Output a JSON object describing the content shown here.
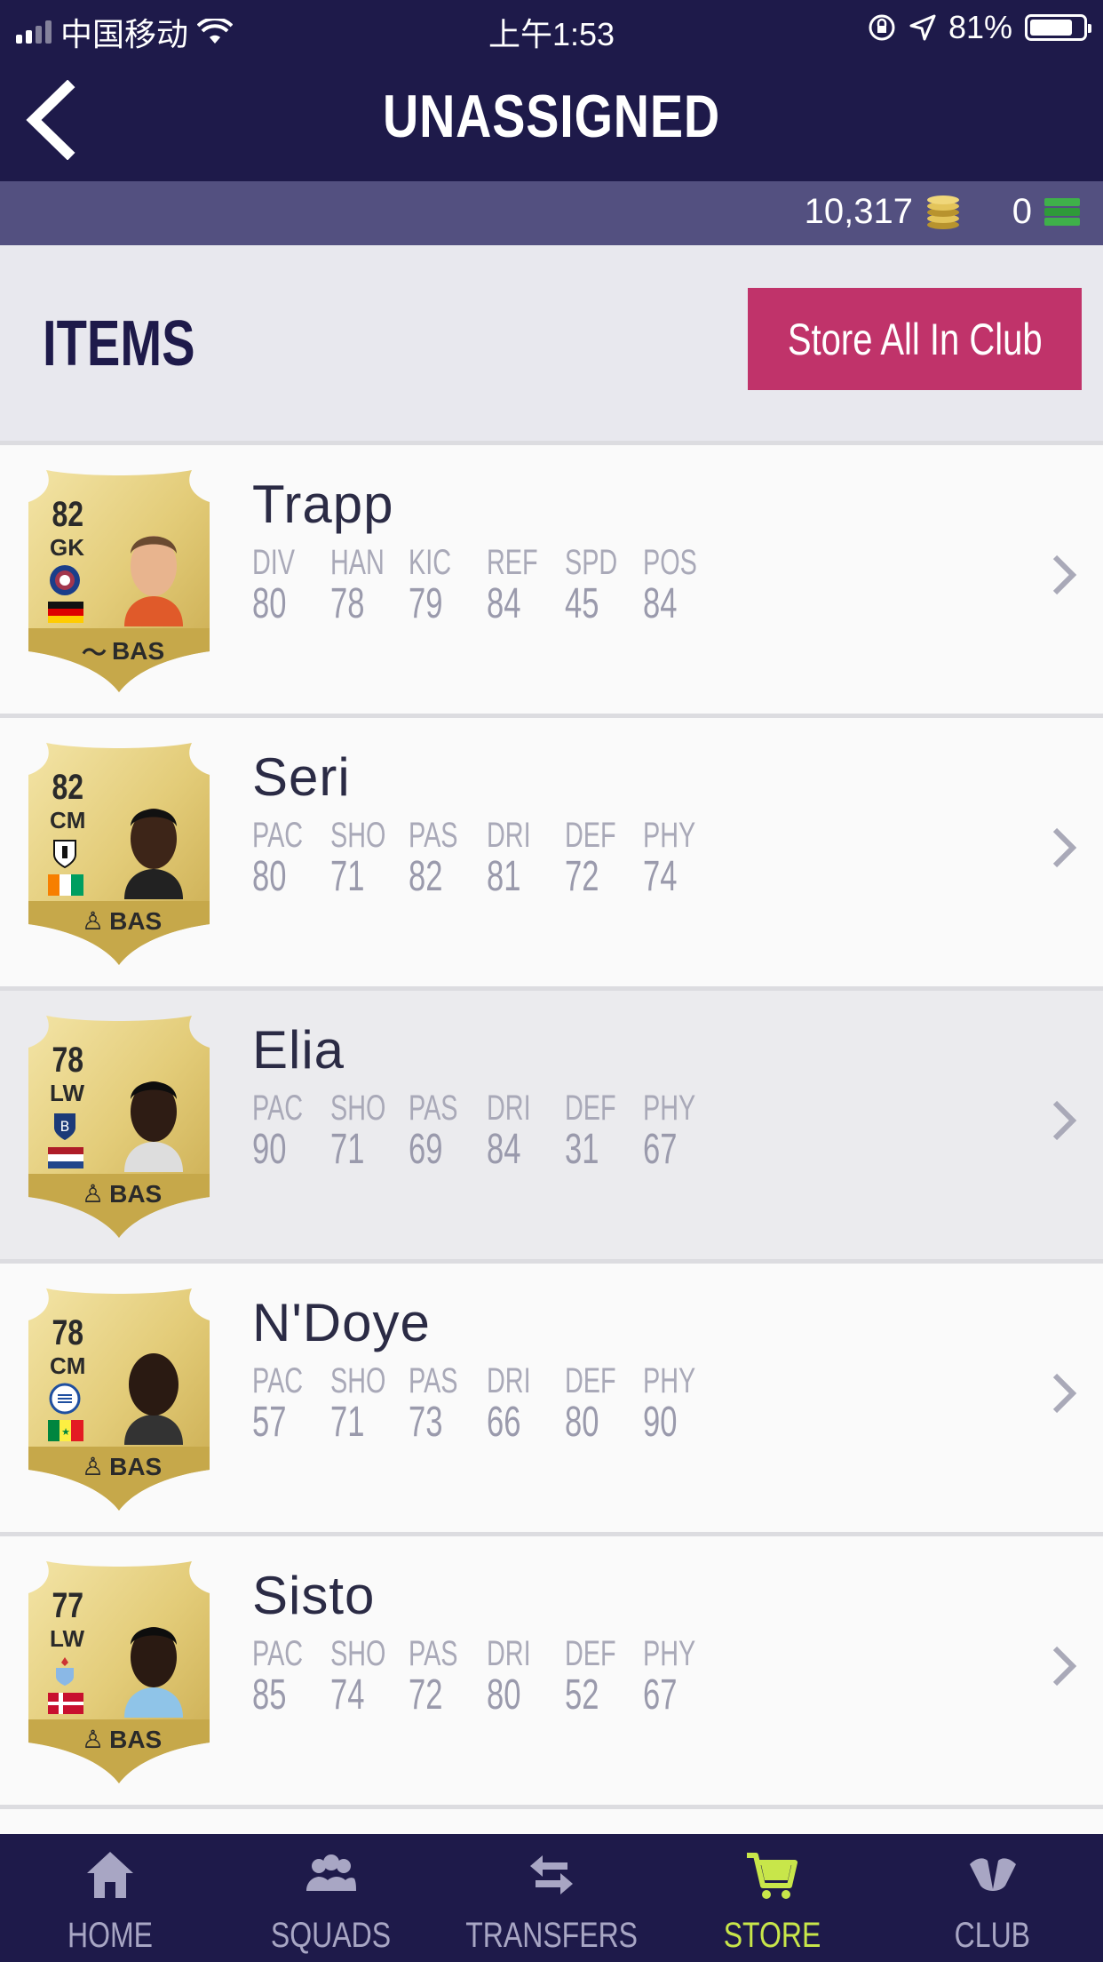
{
  "status_bar": {
    "carrier": "中国移动",
    "time": "上午1:53",
    "battery": "81%",
    "battery_level": 0.81
  },
  "nav": {
    "title": "UNASSIGNED"
  },
  "currency": {
    "coins": "10,317",
    "points": "0"
  },
  "items": {
    "title": "ITEMS",
    "store_button": "Store All In Club"
  },
  "players": [
    {
      "name": "Trapp",
      "rating": "82",
      "position": "GK",
      "tag": "BAS",
      "flag": "germany",
      "stats": [
        {
          "label": "DIV",
          "value": "80"
        },
        {
          "label": "HAN",
          "value": "78"
        },
        {
          "label": "KIC",
          "value": "79"
        },
        {
          "label": "REF",
          "value": "84"
        },
        {
          "label": "SPD",
          "value": "45"
        },
        {
          "label": "POS",
          "value": "84"
        }
      ]
    },
    {
      "name": "Seri",
      "rating": "82",
      "position": "CM",
      "tag": "BAS",
      "flag": "ivory-coast",
      "stats": [
        {
          "label": "PAC",
          "value": "80"
        },
        {
          "label": "SHO",
          "value": "71"
        },
        {
          "label": "PAS",
          "value": "82"
        },
        {
          "label": "DRI",
          "value": "81"
        },
        {
          "label": "DEF",
          "value": "72"
        },
        {
          "label": "PHY",
          "value": "74"
        }
      ]
    },
    {
      "name": "Elia",
      "rating": "78",
      "position": "LW",
      "tag": "BAS",
      "flag": "netherlands",
      "stats": [
        {
          "label": "PAC",
          "value": "90"
        },
        {
          "label": "SHO",
          "value": "71"
        },
        {
          "label": "PAS",
          "value": "69"
        },
        {
          "label": "DRI",
          "value": "84"
        },
        {
          "label": "DEF",
          "value": "31"
        },
        {
          "label": "PHY",
          "value": "67"
        }
      ]
    },
    {
      "name": "N'Doye",
      "rating": "78",
      "position": "CM",
      "tag": "BAS",
      "flag": "senegal",
      "stats": [
        {
          "label": "PAC",
          "value": "57"
        },
        {
          "label": "SHO",
          "value": "71"
        },
        {
          "label": "PAS",
          "value": "73"
        },
        {
          "label": "DRI",
          "value": "66"
        },
        {
          "label": "DEF",
          "value": "80"
        },
        {
          "label": "PHY",
          "value": "90"
        }
      ]
    },
    {
      "name": "Sisto",
      "rating": "77",
      "position": "LW",
      "tag": "BAS",
      "flag": "denmark",
      "stats": [
        {
          "label": "PAC",
          "value": "85"
        },
        {
          "label": "SHO",
          "value": "74"
        },
        {
          "label": "PAS",
          "value": "72"
        },
        {
          "label": "DRI",
          "value": "80"
        },
        {
          "label": "DEF",
          "value": "52"
        },
        {
          "label": "PHY",
          "value": "67"
        }
      ]
    }
  ],
  "tabs": [
    {
      "label": "HOME",
      "icon": "home-icon"
    },
    {
      "label": "SQUADS",
      "icon": "squads-icon"
    },
    {
      "label": "TRANSFERS",
      "icon": "transfers-icon"
    },
    {
      "label": "STORE",
      "icon": "cart-icon",
      "active": true
    },
    {
      "label": "CLUB",
      "icon": "club-icon"
    }
  ],
  "colors": {
    "navy": "#1e1a4a",
    "accent_pink": "#c0336a",
    "active_tab": "#c8e64a",
    "gold": "#d8bf5c"
  }
}
